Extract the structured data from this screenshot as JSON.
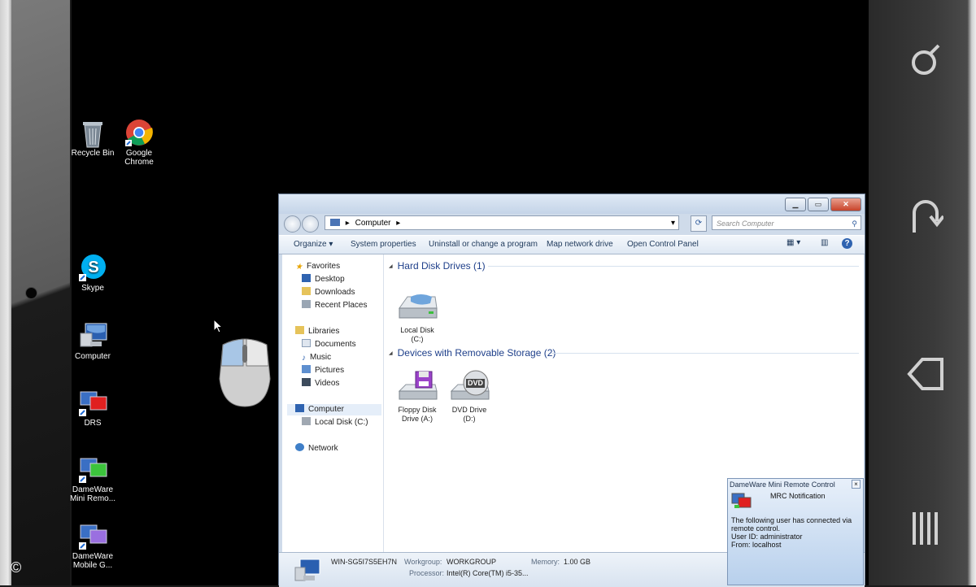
{
  "copyright": "©",
  "desktop": {
    "icons": [
      {
        "label": "Recycle Bin"
      },
      {
        "label": "Google\nChrome"
      },
      {
        "label": "Skype"
      },
      {
        "label": "Computer"
      },
      {
        "label": "DRS"
      },
      {
        "label": "DameWare\nMini Remo..."
      },
      {
        "label": "DameWare\nMobile G..."
      }
    ]
  },
  "explorer": {
    "address": {
      "path": "Computer",
      "separator": "▸"
    },
    "search_placeholder": "Search Computer",
    "toolbar": {
      "organize": "Organize ▾",
      "system_properties": "System properties",
      "uninstall": "Uninstall or change a program",
      "map_drive": "Map network drive",
      "control_panel": "Open Control Panel"
    },
    "nav": {
      "favorites": "Favorites",
      "desktop": "Desktop",
      "downloads": "Downloads",
      "recent": "Recent Places",
      "libraries": "Libraries",
      "documents": "Documents",
      "music": "Music",
      "pictures": "Pictures",
      "videos": "Videos",
      "computer": "Computer",
      "local_disk": "Local Disk (C:)",
      "network": "Network"
    },
    "groups": {
      "hdd": "Hard Disk Drives (1)",
      "removable": "Devices with Removable Storage (2)"
    },
    "drives": {
      "c": "Local Disk\n(C:)",
      "a": "Floppy Disk\nDrive (A:)",
      "d": "DVD Drive\n(D:)",
      "dvd_badge": "DVD"
    },
    "details": {
      "computer_name": "WIN-SG5I7S5EH7N",
      "workgroup_label": "Workgroup:",
      "workgroup": "WORKGROUP",
      "memory_label": "Memory:",
      "memory": "1.00 GB",
      "processor_label": "Processor:",
      "processor": "Intel(R) Core(TM) i5-35..."
    }
  },
  "notification": {
    "title": "DameWare Mini Remote Control",
    "heading": "MRC Notification",
    "line1": "The following user has connected via",
    "line2": "remote control.",
    "line3": "User ID: administrator",
    "line4": "From: localhost",
    "close": "×"
  }
}
